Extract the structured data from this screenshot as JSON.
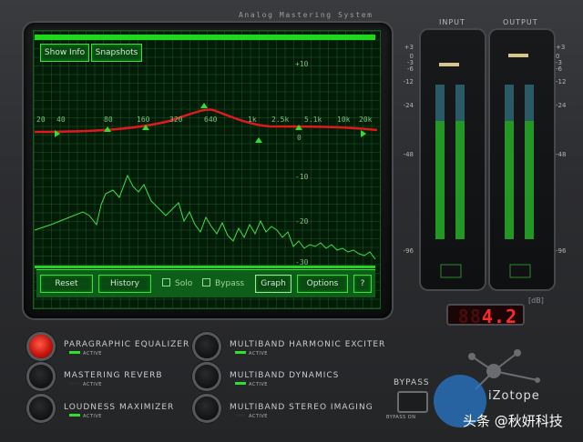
{
  "app_title": "Analog Mastering System",
  "screen": {
    "buttons_top": {
      "show_info": "Show Info",
      "snapshots": "Snapshots"
    },
    "freq_labels": [
      "20",
      "40",
      "80",
      "160",
      "320",
      "640",
      "1k",
      "2.5k",
      "5.1k",
      "10k",
      "20k"
    ],
    "db_labels": [
      "+10",
      "0",
      "-10",
      "-20",
      "-30"
    ],
    "toolbar": {
      "reset": "Reset",
      "history": "History",
      "solo": "Solo",
      "bypass": "Bypass",
      "graph": "Graph",
      "options": "Options",
      "help": "?"
    }
  },
  "meters": {
    "input_title": "INPUT",
    "output_title": "OUTPUT",
    "scale": [
      "+3",
      "0",
      "-3",
      "-6",
      "-12",
      "-24",
      "-48",
      "-96"
    ],
    "unit": "[dB]",
    "readout": "4.2"
  },
  "modules": [
    {
      "label": "PARAGRAPHIC EQUALIZER",
      "status": "ACTIVE",
      "active": true
    },
    {
      "label": "MASTERING REVERB",
      "status": "ACTIVE",
      "active": false
    },
    {
      "label": "LOUDNESS MAXIMIZER",
      "status": "ACTIVE",
      "active": true
    },
    {
      "label": "MULTIBAND HARMONIC EXCITER",
      "status": "ACTIVE",
      "active": true
    },
    {
      "label": "MULTIBAND DYNAMICS",
      "status": "ACTIVE",
      "active": true
    },
    {
      "label": "MULTIBAND STEREO IMAGING",
      "status": "ACTIVE",
      "active": false
    }
  ],
  "bypass": {
    "label": "BYPASS",
    "sub_label": "BYPASS ON"
  },
  "brand": "iZotope",
  "watermark": "头条 @秋妍科技",
  "colors": {
    "screen_green": "#1ed81e",
    "eq_curve": "#e01a1a",
    "led_red": "#ff2a2a"
  }
}
